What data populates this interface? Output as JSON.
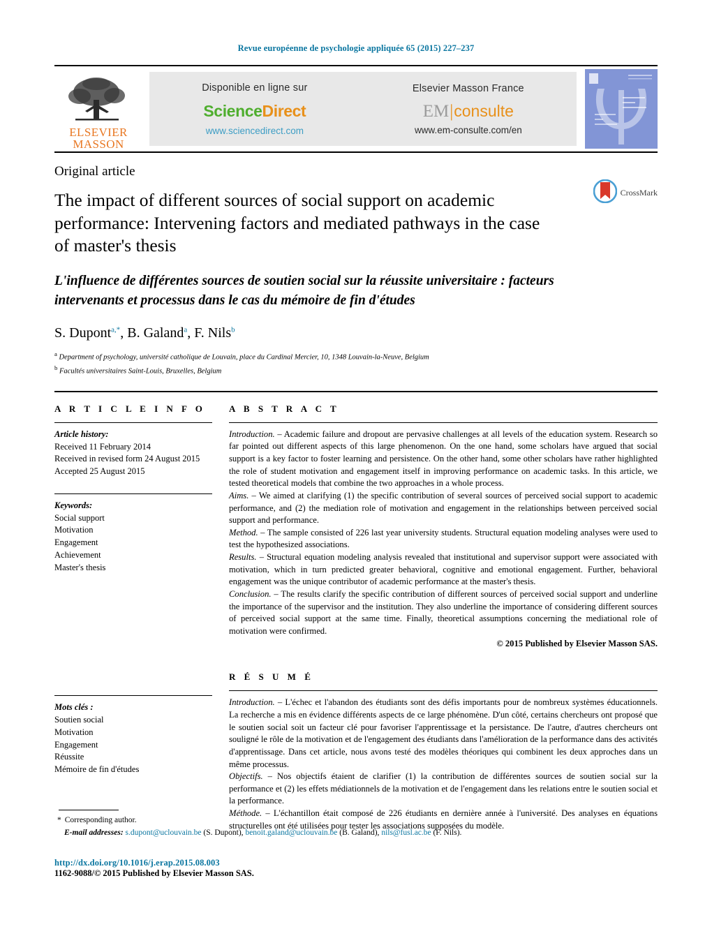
{
  "running_head": "Revue européenne de psychologie appliquée 65 (2015) 227–237",
  "masthead": {
    "publisher_line1": "ELSEVIER",
    "publisher_line2": "MASSON",
    "sciencedirect": {
      "available_label": "Disponible en ligne sur",
      "logo_part1": "Science",
      "logo_part2": "Direct",
      "url": "www.sciencedirect.com"
    },
    "emconsulte": {
      "available_label": "Elsevier Masson France",
      "logo_part1": "EM",
      "logo_divider": "|",
      "logo_part2": "consulte",
      "url": "www.em-consulte.com/en"
    }
  },
  "article": {
    "kicker": "Original article",
    "title_en": "The impact of different sources of social support on academic performance: Intervening factors and mediated pathways in the case of master's thesis",
    "title_fr": "L'influence de différentes sources de soutien social sur la réussite universitaire : facteurs intervenants et processus dans le cas du mémoire de fin d'études",
    "crossmark_label": "CrossMark",
    "authors": [
      {
        "name": "S. Dupont",
        "marks": "a,*"
      },
      {
        "name": "B. Galand",
        "marks": "a"
      },
      {
        "name": "F. Nils",
        "marks": "b"
      }
    ],
    "affiliations": [
      {
        "mark": "a",
        "text": "Department of psychology, université catholique de Louvain, place du Cardinal Mercier, 10, 1348 Louvain-la-Neuve, Belgium"
      },
      {
        "mark": "b",
        "text": "Facultés universitaires Saint-Louis, Bruxelles, Belgium"
      }
    ]
  },
  "article_info": {
    "heading": "A R T I C L E   I N F O",
    "history_title": "Article history:",
    "history": [
      "Received 11 February 2014",
      "Received in revised form 24 August 2015",
      "Accepted 25 August 2015"
    ],
    "keywords_title": "Keywords:",
    "keywords": [
      "Social support",
      "Motivation",
      "Engagement",
      "Achievement",
      "Master's thesis"
    ]
  },
  "resume_info": {
    "keywords_title": "Mots clés :",
    "keywords": [
      "Soutien social",
      "Motivation",
      "Engagement",
      "Réussite",
      "Mémoire de fin d'études"
    ]
  },
  "abstract": {
    "heading": "A B S T R A C T",
    "paragraphs": [
      {
        "lead": "Introduction.",
        "text": " – Academic failure and dropout are pervasive challenges at all levels of the education system. Research so far pointed out different aspects of this large phenomenon. On the one hand, some scholars have argued that social support is a key factor to foster learning and persistence. On the other hand, some other scholars have rather highlighted the role of student motivation and engagement itself in improving performance on academic tasks. In this article, we tested theoretical models that combine the two approaches in a whole process."
      },
      {
        "lead": "Aims.",
        "text": " – We aimed at clarifying (1) the specific contribution of several sources of perceived social support to academic performance, and (2) the mediation role of motivation and engagement in the relationships between perceived social support and performance."
      },
      {
        "lead": "Method.",
        "text": " – The sample consisted of 226 last year university students. Structural equation modeling analyses were used to test the hypothesized associations."
      },
      {
        "lead": "Results.",
        "text": " – Structural equation modeling analysis revealed that institutional and supervisor support were associated with motivation, which in turn predicted greater behavioral, cognitive and emotional engagement. Further, behavioral engagement was the unique contributor of academic performance at the master's thesis."
      },
      {
        "lead": "Conclusion.",
        "text": " – The results clarify the specific contribution of different sources of perceived social support and underline the importance of the supervisor and the institution. They also underline the importance of considering different sources of perceived social support at the same time. Finally, theoretical assumptions concerning the mediational role of motivation were confirmed."
      }
    ],
    "copyright": "© 2015 Published by Elsevier Masson SAS."
  },
  "resume": {
    "heading": "R É S U M É",
    "paragraphs": [
      {
        "lead": "Introduction.",
        "text": " – L'échec et l'abandon des étudiants sont des défis importants pour de nombreux systèmes éducationnels. La recherche a mis en évidence différents aspects de ce large phénomène. D'un côté, certains chercheurs ont proposé que le soutien social soit un facteur clé pour favoriser l'apprentissage et la persistance. De l'autre, d'autres chercheurs ont souligné le rôle de la motivation et de l'engagement des étudiants dans l'amélioration de la performance dans des activités d'apprentissage. Dans cet article, nous avons testé des modèles théoriques qui combinent les deux approches dans un même processus."
      },
      {
        "lead": "Objectifs.",
        "text": " – Nos objectifs étaient de clarifier (1) la contribution de différentes sources de soutien social sur la performance et (2) les effets médiationnels de la motivation et de l'engagement dans les relations entre le soutien social et la performance."
      },
      {
        "lead": "Méthode.",
        "text": " – L'échantillon était composé de 226 étudiants en dernière année à l'université. Des analyses en équations structurelles ont été utilisées pour tester les associations supposées du modèle."
      }
    ]
  },
  "footer": {
    "corresponding_star": "*",
    "corresponding_label": "Corresponding author.",
    "email_label": "E-mail addresses:",
    "emails": [
      {
        "address": "s.dupont@uclouvain.be",
        "owner": " (S. Dupont), "
      },
      {
        "address": "benoit.galand@uclouvain.be",
        "owner": " (B. Galand), "
      },
      {
        "address": "nils@fusl.ac.be",
        "owner": " (F. Nils)."
      }
    ],
    "doi": "http://dx.doi.org/10.1016/j.erap.2015.08.003",
    "issn_line": "1162-9088/© 2015 Published by Elsevier Masson SAS."
  },
  "colors": {
    "link": "#0b76a0",
    "elsevier_orange": "#e87722",
    "sciencedirect_green": "#4fae2e",
    "sciencedirect_orange": "#e8901a",
    "banner_bg": "#e8e8e8"
  }
}
